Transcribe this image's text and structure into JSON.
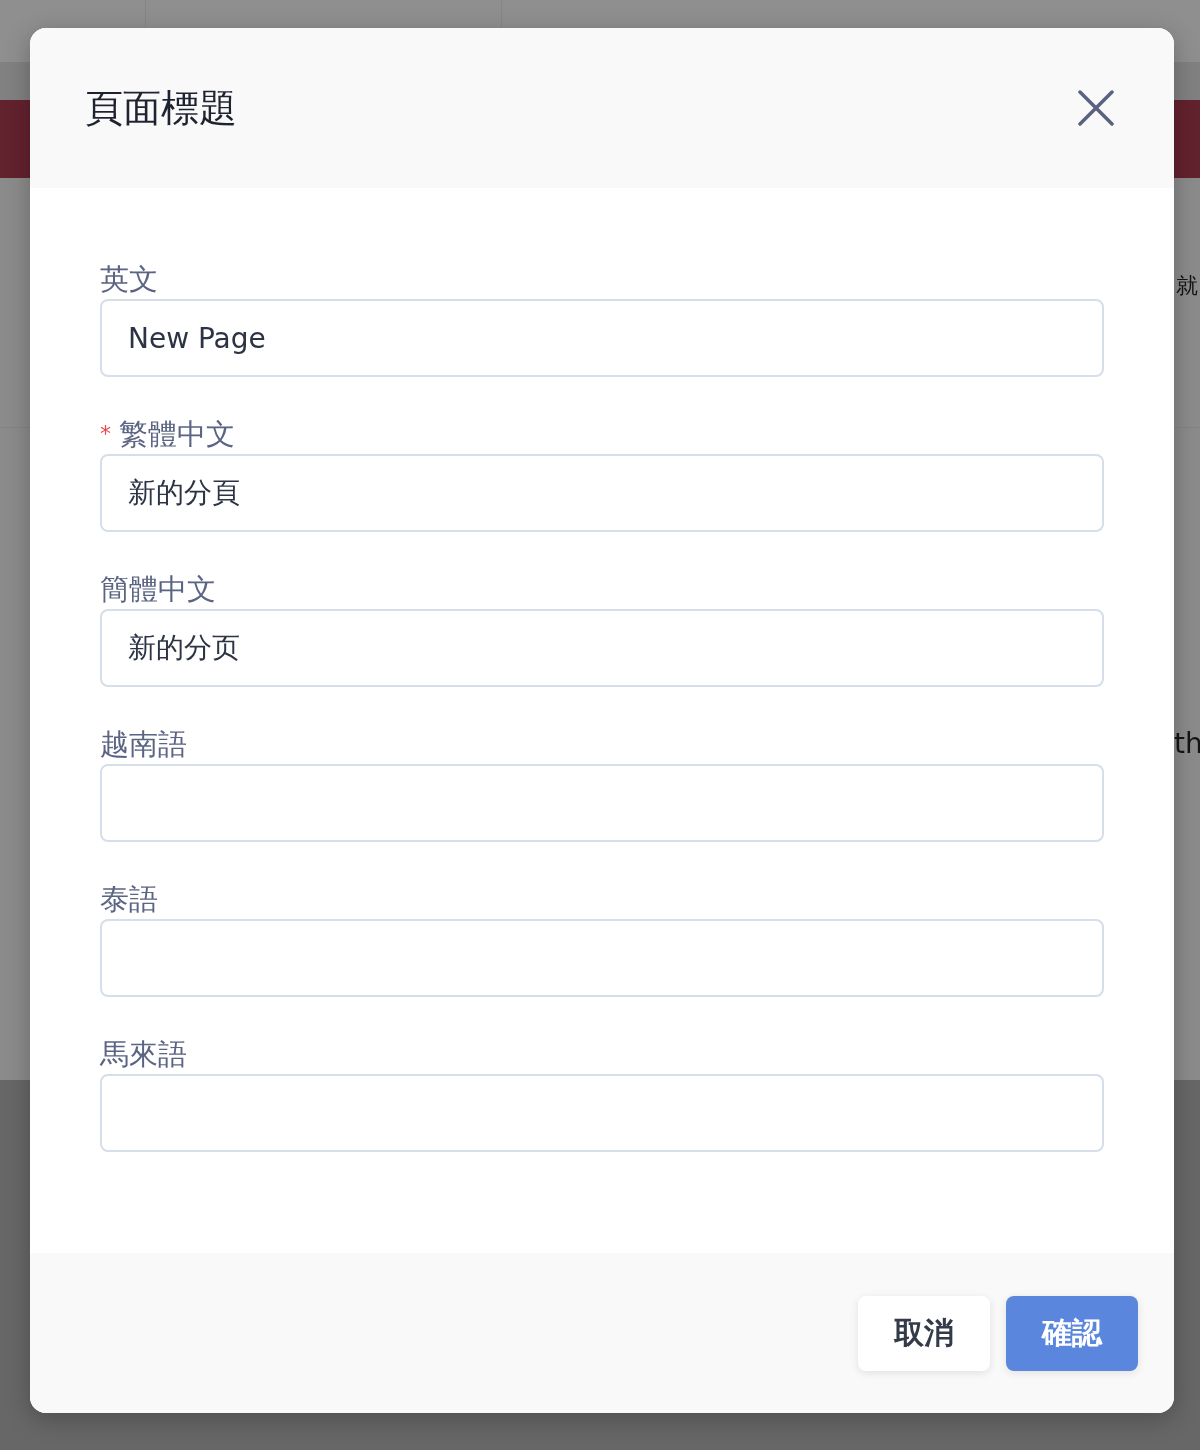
{
  "background": {
    "texts": [
      "就",
      "th"
    ]
  },
  "dialog": {
    "title": "頁面標題",
    "fields": [
      {
        "label": "英文",
        "value": "New Page"
      },
      {
        "label": "繁體中文",
        "required_mark": "*",
        "value": "新的分頁"
      },
      {
        "label": "簡體中文",
        "value": "新的分页"
      },
      {
        "label": "越南語"
      },
      {
        "label": "泰語"
      },
      {
        "label": "馬來語"
      }
    ],
    "buttons": [
      {
        "label": "取消",
        "kind": "secondary"
      },
      {
        "label": "確認",
        "kind": "primary"
      }
    ]
  }
}
